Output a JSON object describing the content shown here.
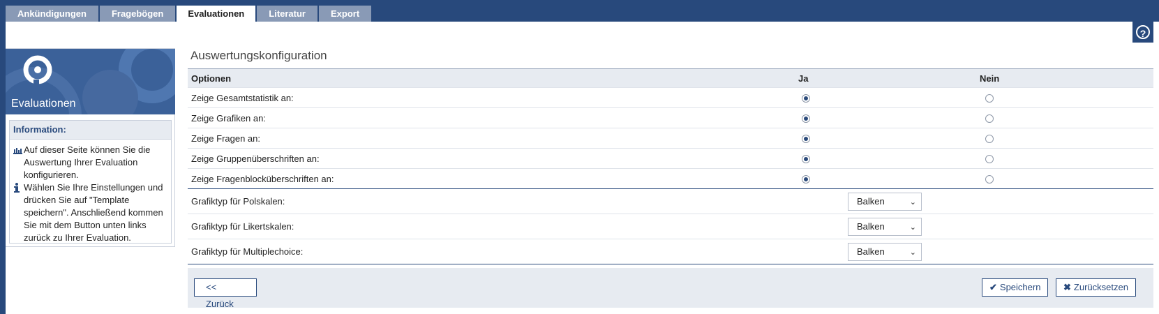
{
  "tabs": [
    "Ankündigungen",
    "Fragebögen",
    "Evaluationen",
    "Literatur",
    "Export"
  ],
  "help": {
    "symbol": "?"
  },
  "sidebar": {
    "title": "Evaluationen",
    "info_heading": "Information:",
    "info_items": [
      {
        "icon": "bar-chart-icon",
        "text": "Auf dieser Seite können Sie die Auswertung Ihrer Evaluation konfigurieren."
      },
      {
        "icon": "info-icon",
        "text": "Wählen Sie Ihre Einstellungen und drücken Sie auf \"Template speichern\". Anschließend kommen Sie mit dem Button unten links zurück zu Ihrer Evaluation."
      }
    ]
  },
  "main": {
    "title": "Auswertungskonfiguration",
    "columns": {
      "options": "Optionen",
      "yes": "Ja",
      "no": "Nein"
    },
    "radio_rows": [
      {
        "label": "Zeige Gesamtstatistik an:",
        "selected": "Ja"
      },
      {
        "label": "Zeige Grafiken an:",
        "selected": "Ja"
      },
      {
        "label": "Zeige Fragen an:",
        "selected": "Ja"
      },
      {
        "label": "Zeige Gruppenüberschriften an:",
        "selected": "Ja"
      },
      {
        "label": "Zeige Fragenblocküberschriften an:",
        "selected": "Ja"
      }
    ],
    "select_rows": [
      {
        "label": "Grafiktyp für Polskalen:",
        "value": "Balken"
      },
      {
        "label": "Grafiktyp für Likertskalen:",
        "value": "Balken"
      },
      {
        "label": "Grafiktyp für Multiplechoice:",
        "value": "Balken"
      }
    ]
  },
  "footer": {
    "back": "<< Zurück",
    "save": "Speichern",
    "reset": "Zurücksetzen"
  },
  "colors": {
    "brand": "#28497c",
    "tab_inactive": "#899ab6",
    "header_bg": "#e7ebf1"
  }
}
